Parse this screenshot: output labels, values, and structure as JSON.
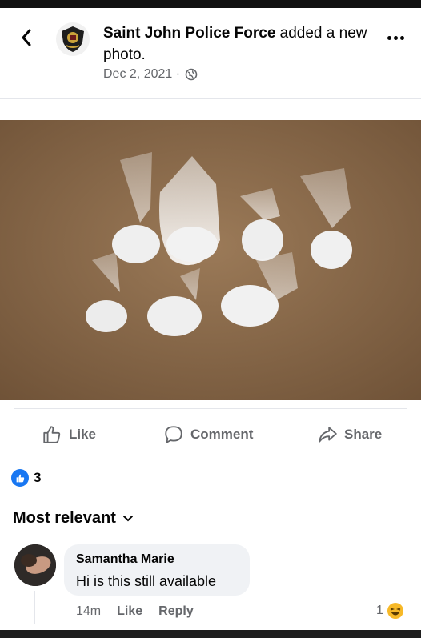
{
  "post": {
    "page_name": "Saint John Police Force",
    "action_text": " added a new photo.",
    "date": "Dec 2, 2021 ·",
    "privacy_icon": "globe-icon"
  },
  "actions": {
    "like": "Like",
    "comment": "Comment",
    "share": "Share"
  },
  "reactions": {
    "count": "3"
  },
  "comments_section": {
    "sort_label": "Most relevant"
  },
  "comment": {
    "author": "Samantha Marie",
    "text": "Hi is this still available",
    "time": "14m",
    "like": "Like",
    "reply": "Reply",
    "reaction_count": "1"
  },
  "colors": {
    "accent": "#1877f2",
    "secondary_text": "#65676b",
    "bubble": "#f0f2f5",
    "photo_bg": "#8a6a4a"
  }
}
